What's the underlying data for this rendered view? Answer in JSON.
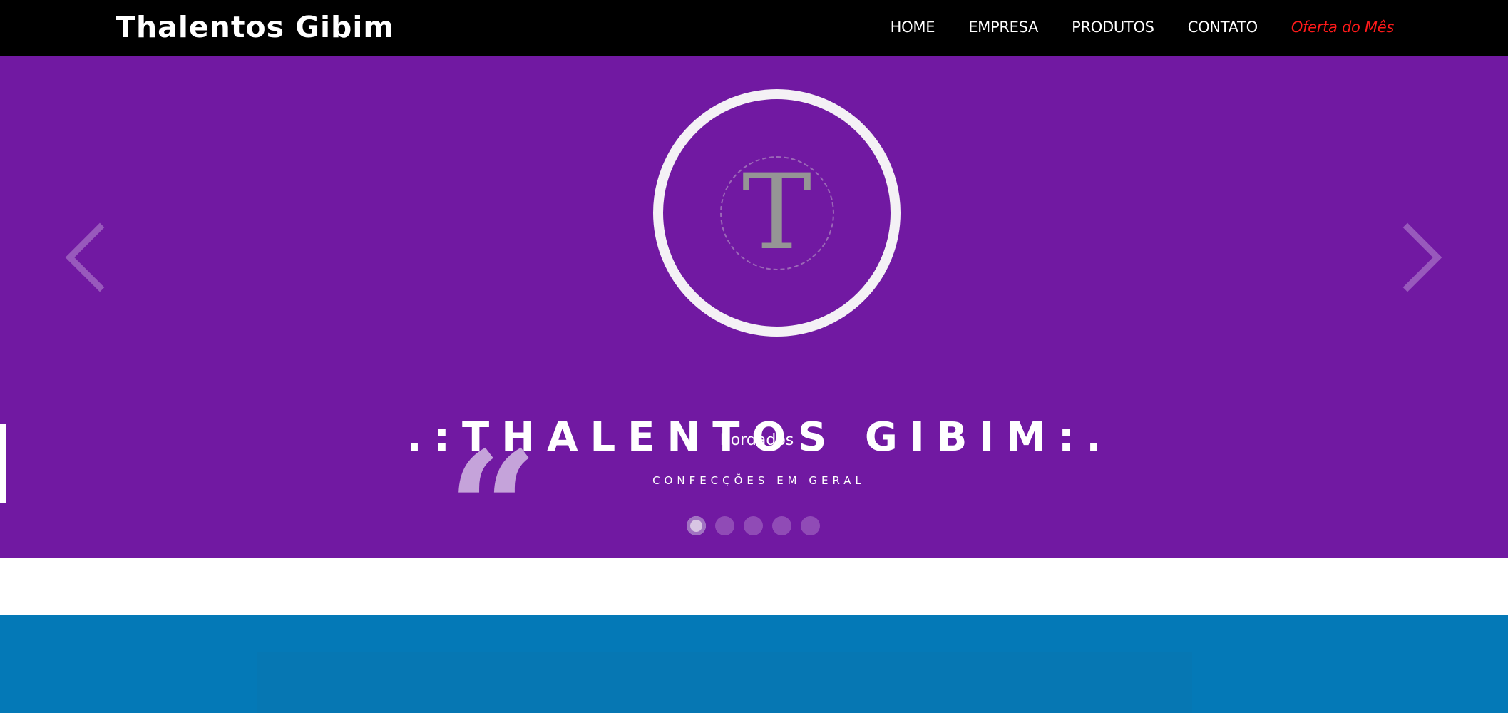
{
  "navbar": {
    "brand": "Thalentos Gibim",
    "items": [
      {
        "label": "HOME"
      },
      {
        "label": "EMPRESA"
      },
      {
        "label": "PRODUTOS"
      },
      {
        "label": "CONTATO"
      },
      {
        "label": "Oferta do Mês"
      }
    ]
  },
  "hero": {
    "logo_letter": "T",
    "title": ".:THALENTOS GIBIM:.",
    "quote_mark": "“",
    "subtitle": "Bordados",
    "tagline": "CONFECÇÕES EM GERAL",
    "slide_count": 5,
    "active_slide": 1,
    "prev_icon": "chevron-left-icon",
    "next_icon": "chevron-right-icon"
  },
  "colors": {
    "navbar_bg": "#000000",
    "hero_bg": "#7119a2",
    "offer_text": "#ff1a1a",
    "blue_section_bg": "#0479b7"
  }
}
